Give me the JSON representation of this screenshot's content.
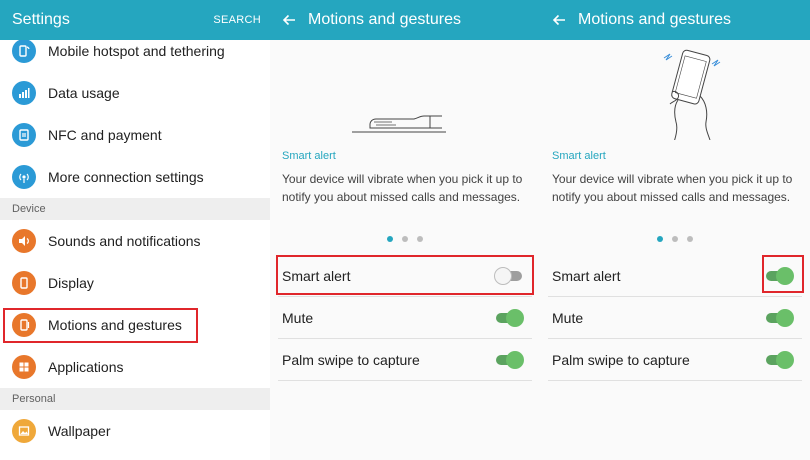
{
  "settings_panel": {
    "title": "Settings",
    "action": "SEARCH",
    "items_top": [
      {
        "label": "Mobile hotspot and tethering",
        "icon": "hotspot-icon",
        "color": "#2b9ad6"
      },
      {
        "label": "Data usage",
        "icon": "data-usage-icon",
        "color": "#2b9ad6"
      },
      {
        "label": "NFC and payment",
        "icon": "nfc-icon",
        "color": "#2b9ad6"
      },
      {
        "label": "More connection settings",
        "icon": "connection-icon",
        "color": "#2b9ad6"
      }
    ],
    "section_device": "Device",
    "items_device": [
      {
        "label": "Sounds and notifications",
        "icon": "sound-icon",
        "color": "#e8772b"
      },
      {
        "label": "Display",
        "icon": "display-icon",
        "color": "#e8772b"
      },
      {
        "label": "Motions and gestures",
        "icon": "motion-icon",
        "color": "#e8772b"
      },
      {
        "label": "Applications",
        "icon": "applications-icon",
        "color": "#e8772b"
      }
    ],
    "section_personal": "Personal",
    "items_personal": [
      {
        "label": "Wallpaper",
        "icon": "wallpaper-icon",
        "color": "#efa83a"
      }
    ]
  },
  "detail_panel_1": {
    "title": "Motions and gestures",
    "feature_title": "Smart alert",
    "feature_desc": "Your device will vibrate when you pick it up to notify you about missed calls and messages.",
    "toggles": [
      {
        "label": "Smart alert",
        "state": "off"
      },
      {
        "label": "Mute",
        "state": "on"
      },
      {
        "label": "Palm swipe to capture",
        "state": "on"
      }
    ]
  },
  "detail_panel_2": {
    "title": "Motions and gestures",
    "feature_title": "Smart alert",
    "feature_desc": "Your device will vibrate when you pick it up to notify you about missed calls and messages.",
    "toggles": [
      {
        "label": "Smart alert",
        "state": "on"
      },
      {
        "label": "Mute",
        "state": "on"
      },
      {
        "label": "Palm swipe to capture",
        "state": "on"
      }
    ]
  },
  "colors": {
    "accent": "#25a6bf",
    "highlight": "#e0262b",
    "toggle_on": "#6abf69"
  }
}
